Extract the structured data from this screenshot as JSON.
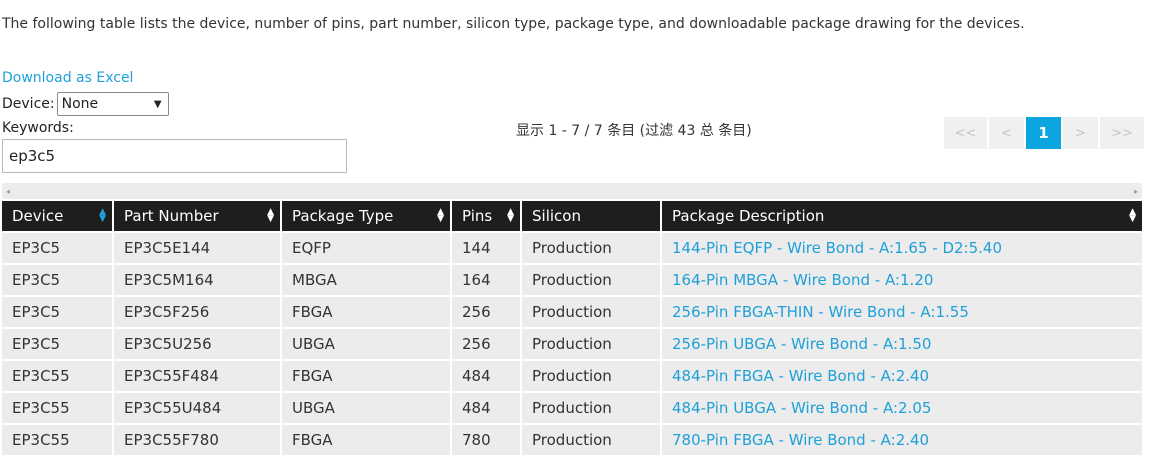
{
  "intro_text": "The following table lists the device, number of pins, part number, silicon type, package type, and downloadable package drawing for the devices.",
  "download_link": "Download as Excel",
  "device_filter": {
    "label": "Device:",
    "selected": "None"
  },
  "keywords": {
    "label": "Keywords:",
    "value": "ep3c5"
  },
  "info_text": "显示 1 - 7 / 7 条目 (过滤 43 总 条目)",
  "pager": {
    "first": "<<",
    "prev": "<",
    "current": "1",
    "next": ">",
    "last": ">>"
  },
  "scrollbar": {
    "left_arrow": "◂",
    "right_arrow": "▸"
  },
  "table": {
    "headers": [
      "Device",
      "Part Number",
      "Package Type",
      "Pins",
      "Silicon",
      "Package Description"
    ],
    "rows": [
      [
        "EP3C5",
        "EP3C5E144",
        "EQFP",
        "144",
        "Production",
        "144-Pin EQFP - Wire Bond - A:1.65 - D2:5.40"
      ],
      [
        "EP3C5",
        "EP3C5M164",
        "MBGA",
        "164",
        "Production",
        "164-Pin MBGA - Wire Bond - A:1.20"
      ],
      [
        "EP3C5",
        "EP3C5F256",
        "FBGA",
        "256",
        "Production",
        "256-Pin FBGA-THIN - Wire Bond - A:1.55"
      ],
      [
        "EP3C5",
        "EP3C5U256",
        "UBGA",
        "256",
        "Production",
        "256-Pin UBGA - Wire Bond - A:1.50"
      ],
      [
        "EP3C55",
        "EP3C55F484",
        "FBGA",
        "484",
        "Production",
        "484-Pin FBGA - Wire Bond - A:2.40"
      ],
      [
        "EP3C55",
        "EP3C55U484",
        "UBGA",
        "484",
        "Production",
        "484-Pin UBGA - Wire Bond - A:2.05"
      ],
      [
        "EP3C55",
        "EP3C55F780",
        "FBGA",
        "780",
        "Production",
        "780-Pin FBGA - Wire Bond - A:2.40"
      ]
    ]
  },
  "colors": {
    "link": "#1fa0d8",
    "header_bg": "#1e1e1e",
    "row_bg": "#ececec",
    "pager_active": "#0ba6e0"
  }
}
